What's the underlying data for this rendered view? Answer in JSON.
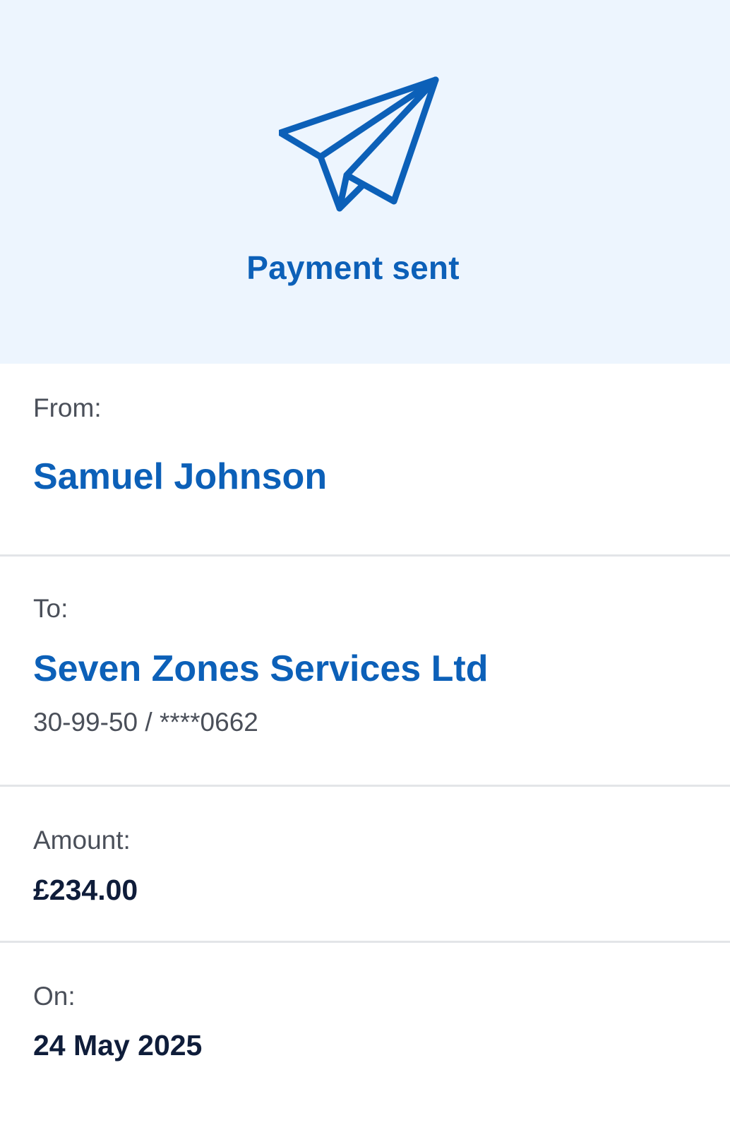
{
  "header": {
    "icon": "paper-plane-icon",
    "title": "Payment sent",
    "accent_color": "#0c60b8",
    "background_color": "#edf5fe"
  },
  "details": {
    "from": {
      "label": "From:",
      "name": "Samuel Johnson"
    },
    "to": {
      "label": "To:",
      "name": "Seven Zones Services Ltd",
      "account": "30-99-50 / ****0662"
    },
    "amount": {
      "label": "Amount:",
      "value": "£234.00"
    },
    "date": {
      "label": "On:",
      "value": "24 May 2025"
    }
  }
}
